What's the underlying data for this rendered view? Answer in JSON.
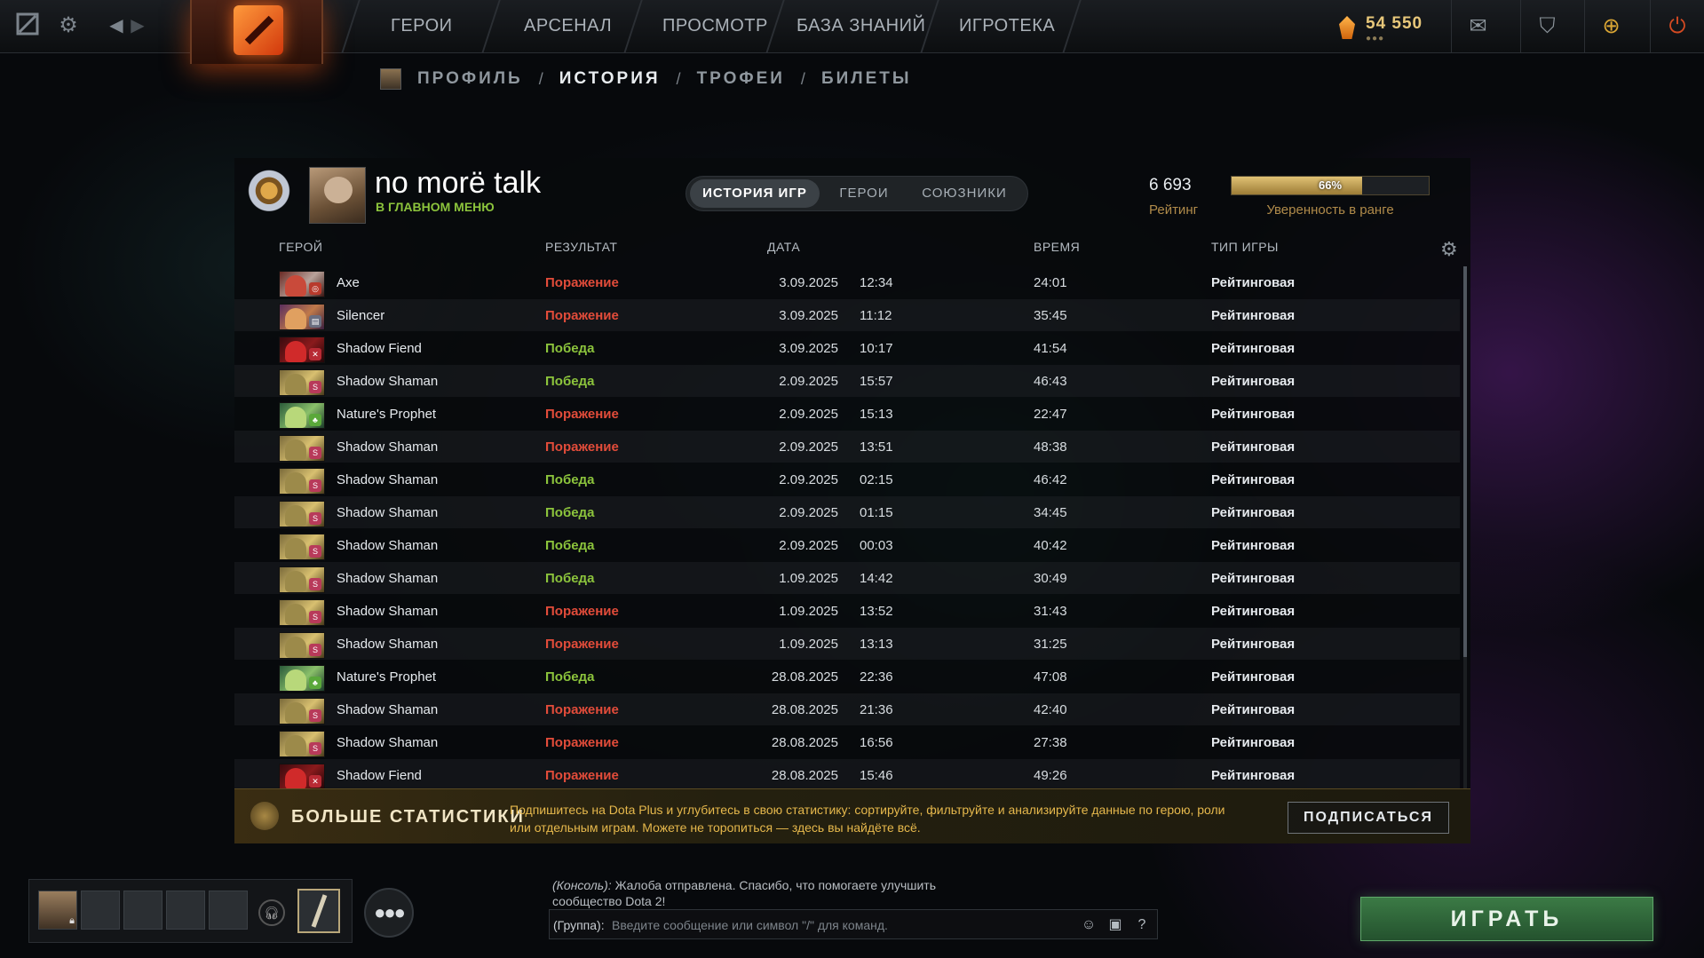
{
  "topbar": {
    "nav": [
      "ГЕРОИ",
      "АРСЕНАЛ",
      "ПРОСМОТР",
      "БАЗА ЗНАНИЙ",
      "ИГРОТЕКА"
    ],
    "currency": "54 550"
  },
  "breadcrumb": {
    "items": [
      "ПРОФИЛЬ",
      "ИСТОРИЯ",
      "ТРОФЕИ",
      "БИЛЕТЫ"
    ],
    "active": "ИСТОРИЯ"
  },
  "profile": {
    "name": "no morë talk",
    "status": "В ГЛАВНОМ МЕНЮ",
    "tabs": [
      "ИСТОРИЯ ИГР",
      "ГЕРОИ",
      "СОЮЗНИКИ"
    ],
    "rating_value": "6 693",
    "rating_label": "Рейтинг",
    "confidence_pct": "66%",
    "confidence_fraction": 0.66,
    "confidence_label": "Уверенность в ранге"
  },
  "table": {
    "headers": {
      "hero": "ГЕРОЙ",
      "result": "РЕЗУЛЬТАТ",
      "date": "ДАТА",
      "duration": "ВРЕМЯ",
      "type": "ТИП ИГРЫ"
    },
    "rows": [
      {
        "hero": "Axe",
        "result": "Поражение",
        "outcome": "loss",
        "date": "3.09.2025",
        "time": "12:34",
        "duration": "24:01",
        "type": "Рейтинговая",
        "portrait": "axe"
      },
      {
        "hero": "Silencer",
        "result": "Поражение",
        "outcome": "loss",
        "date": "3.09.2025",
        "time": "11:12",
        "duration": "35:45",
        "type": "Рейтинговая",
        "portrait": "silencer"
      },
      {
        "hero": "Shadow Fiend",
        "result": "Победа",
        "outcome": "win",
        "date": "3.09.2025",
        "time": "10:17",
        "duration": "41:54",
        "type": "Рейтинговая",
        "portrait": "sf"
      },
      {
        "hero": "Shadow Shaman",
        "result": "Победа",
        "outcome": "win",
        "date": "2.09.2025",
        "time": "15:57",
        "duration": "46:43",
        "type": "Рейтинговая",
        "portrait": "shaman"
      },
      {
        "hero": "Nature's Prophet",
        "result": "Поражение",
        "outcome": "loss",
        "date": "2.09.2025",
        "time": "15:13",
        "duration": "22:47",
        "type": "Рейтинговая",
        "portrait": "prophet"
      },
      {
        "hero": "Shadow Shaman",
        "result": "Поражение",
        "outcome": "loss",
        "date": "2.09.2025",
        "time": "13:51",
        "duration": "48:38",
        "type": "Рейтинговая",
        "portrait": "shaman"
      },
      {
        "hero": "Shadow Shaman",
        "result": "Победа",
        "outcome": "win",
        "date": "2.09.2025",
        "time": "02:15",
        "duration": "46:42",
        "type": "Рейтинговая",
        "portrait": "shaman"
      },
      {
        "hero": "Shadow Shaman",
        "result": "Победа",
        "outcome": "win",
        "date": "2.09.2025",
        "time": "01:15",
        "duration": "34:45",
        "type": "Рейтинговая",
        "portrait": "shaman"
      },
      {
        "hero": "Shadow Shaman",
        "result": "Победа",
        "outcome": "win",
        "date": "2.09.2025",
        "time": "00:03",
        "duration": "40:42",
        "type": "Рейтинговая",
        "portrait": "shaman"
      },
      {
        "hero": "Shadow Shaman",
        "result": "Победа",
        "outcome": "win",
        "date": "1.09.2025",
        "time": "14:42",
        "duration": "30:49",
        "type": "Рейтинговая",
        "portrait": "shaman"
      },
      {
        "hero": "Shadow Shaman",
        "result": "Поражение",
        "outcome": "loss",
        "date": "1.09.2025",
        "time": "13:52",
        "duration": "31:43",
        "type": "Рейтинговая",
        "portrait": "shaman"
      },
      {
        "hero": "Shadow Shaman",
        "result": "Поражение",
        "outcome": "loss",
        "date": "1.09.2025",
        "time": "13:13",
        "duration": "31:25",
        "type": "Рейтинговая",
        "portrait": "shaman"
      },
      {
        "hero": "Nature's Prophet",
        "result": "Победа",
        "outcome": "win",
        "date": "28.08.2025",
        "time": "22:36",
        "duration": "47:08",
        "type": "Рейтинговая",
        "portrait": "prophet"
      },
      {
        "hero": "Shadow Shaman",
        "result": "Поражение",
        "outcome": "loss",
        "date": "28.08.2025",
        "time": "21:36",
        "duration": "42:40",
        "type": "Рейтинговая",
        "portrait": "shaman"
      },
      {
        "hero": "Shadow Shaman",
        "result": "Поражение",
        "outcome": "loss",
        "date": "28.08.2025",
        "time": "16:56",
        "duration": "27:38",
        "type": "Рейтинговая",
        "portrait": "shaman"
      },
      {
        "hero": "Shadow Fiend",
        "result": "Поражение",
        "outcome": "loss",
        "date": "28.08.2025",
        "time": "15:46",
        "duration": "49:26",
        "type": "Рейтинговая",
        "portrait": "sf"
      }
    ]
  },
  "promo": {
    "title": "БОЛЬШЕ СТАТИСТИКИ",
    "text": "Подпишитесь на Dota Plus и углубитесь в свою статистику: сортируйте, фильтруйте и анализируйте данные по герою, роли или отдельным играм. Можете не торопиться — здесь вы найдёте всё.",
    "button": "ПОДПИСАТЬСЯ"
  },
  "chat": {
    "console_tag": "(Консоль):",
    "console_message": "Жалоба отправлена. Спасибо, что помогаете улучшить сообщество Dota 2!",
    "prefix": "(Группа):",
    "placeholder": "Введите сообщение или символ \"/\" для команд."
  },
  "play_button": "ИГРАТЬ",
  "colors": {
    "win": "#8cc43c",
    "loss": "#e24c3a",
    "accent_gold": "#b08b4a",
    "play_green": "#3b7a45"
  },
  "icons": [
    "dota-plus-icon",
    "settings-gear-icon",
    "back-arrow-icon",
    "forward-arrow-icon",
    "shard-icon",
    "mail-icon",
    "armory-icon",
    "dota-plus-shop-icon",
    "power-icon",
    "lock-icon",
    "voice-icon",
    "friends-icon",
    "emoji-icon",
    "screenshot-icon",
    "help-icon"
  ]
}
